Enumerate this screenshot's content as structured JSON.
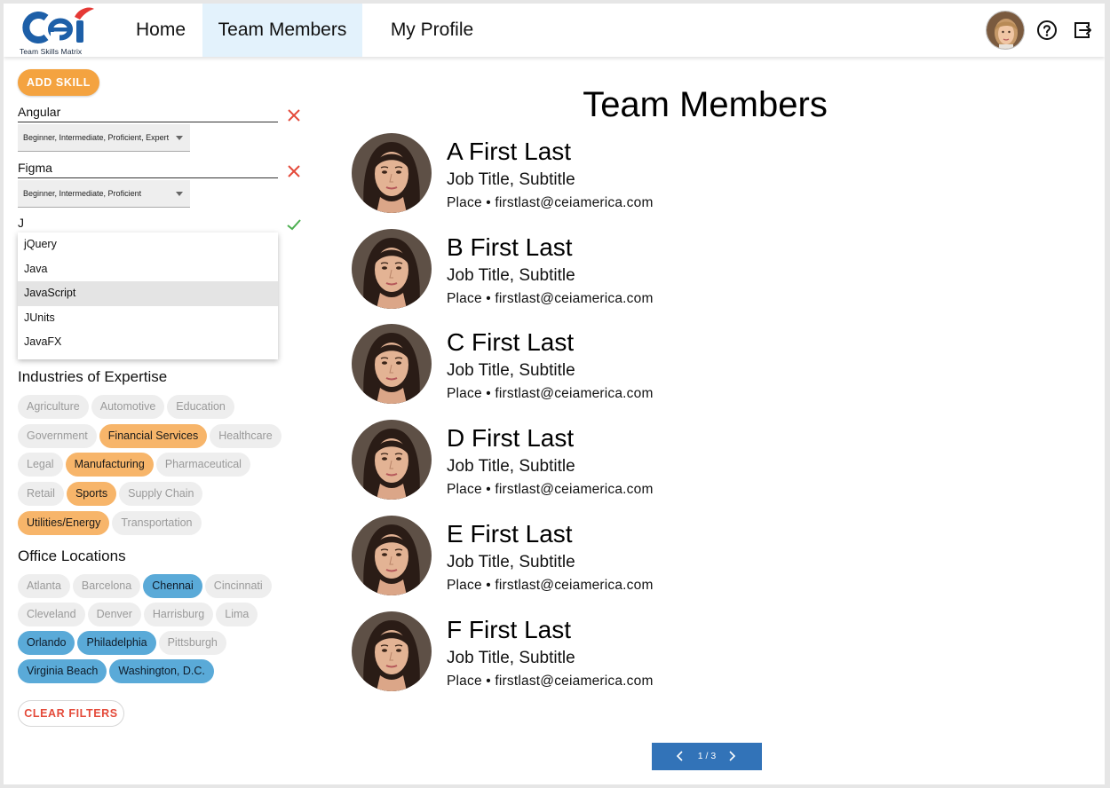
{
  "logo": {
    "text": "cei",
    "tagline": "Team Skills Matrix"
  },
  "nav": {
    "home": "Home",
    "team_members": "Team Members",
    "my_profile": "My Profile"
  },
  "sidebar": {
    "add_skill_label": "ADD SKILL",
    "skills": [
      {
        "name": "Angular",
        "levels": "Beginner, Intermediate, Proficient, Expert"
      },
      {
        "name": "Figma",
        "levels": "Beginner, Intermediate, Proficient"
      }
    ],
    "skill_search_value": "J",
    "suggestions": [
      "jQuery",
      "Java",
      "JavaScript",
      "JUnits",
      "JavaFX"
    ],
    "highlighted_suggestion": "JavaScript",
    "industries_title": "Industries of Expertise",
    "industries": [
      [
        {
          "label": "Agriculture",
          "selected": false
        },
        {
          "label": "Automotive",
          "selected": false
        },
        {
          "label": "Education",
          "selected": false
        }
      ],
      [
        {
          "label": "Government",
          "selected": false
        },
        {
          "label": "Financial Services",
          "selected": true
        },
        {
          "label": "Healthcare",
          "selected": false
        }
      ],
      [
        {
          "label": "Legal",
          "selected": false
        },
        {
          "label": "Manufacturing",
          "selected": true
        },
        {
          "label": "Pharmaceutical",
          "selected": false
        }
      ],
      [
        {
          "label": "Retail",
          "selected": false
        },
        {
          "label": "Sports",
          "selected": true
        },
        {
          "label": "Supply Chain",
          "selected": false
        }
      ],
      [
        {
          "label": "Utilities/Energy",
          "selected": true
        },
        {
          "label": "Transportation",
          "selected": false
        }
      ]
    ],
    "locations_title": "Office Locations",
    "locations": [
      [
        {
          "label": "Atlanta",
          "selected": false
        },
        {
          "label": "Barcelona",
          "selected": false
        },
        {
          "label": "Chennai",
          "selected": true
        },
        {
          "label": "Cincinnati",
          "selected": false
        }
      ],
      [
        {
          "label": "Cleveland",
          "selected": false
        },
        {
          "label": "Denver",
          "selected": false
        },
        {
          "label": "Harrisburg",
          "selected": false
        },
        {
          "label": "Lima",
          "selected": false
        }
      ],
      [
        {
          "label": "Orlando",
          "selected": true
        },
        {
          "label": "Philadelphia",
          "selected": true
        },
        {
          "label": "Pittsburgh",
          "selected": false
        }
      ],
      [
        {
          "label": "Virginia Beach",
          "selected": true
        },
        {
          "label": "Washington, D.C.",
          "selected": true
        }
      ]
    ],
    "clear_filters_label": "CLEAR FILTERS"
  },
  "main": {
    "title": "Team Members",
    "members": [
      {
        "name": "A First Last",
        "title": "Job Title, Subtitle",
        "place": "Place • firstlast@ceiamerica.com"
      },
      {
        "name": "B First Last",
        "title": "Job Title, Subtitle",
        "place": "Place • firstlast@ceiamerica.com"
      },
      {
        "name": "C First Last",
        "title": "Job Title, Subtitle",
        "place": "Place • firstlast@ceiamerica.com"
      },
      {
        "name": "D First Last",
        "title": "Job Title, Subtitle",
        "place": "Place • firstlast@ceiamerica.com"
      },
      {
        "name": "E First Last",
        "title": "Job Title, Subtitle",
        "place": "Place • firstlast@ceiamerica.com"
      },
      {
        "name": "F First Last",
        "title": "Job Title, Subtitle",
        "place": "Place • firstlast@ceiamerica.com"
      }
    ],
    "pagination": {
      "label": "1 / 3",
      "prev_icon": "chevron-left-icon",
      "next_icon": "chevron-right-icon"
    }
  },
  "colors": {
    "accent_orange": "#f4a340",
    "chip_selected_orange": "#f7b56a",
    "chip_selected_blue": "#5aaad8",
    "active_tab_bg": "#e3f2fc",
    "pager_blue": "#3273b8",
    "remove_red": "#e44a3a",
    "confirm_green": "#4caf50",
    "logo_blue": "#1d5fa8",
    "logo_red": "#e53935"
  }
}
